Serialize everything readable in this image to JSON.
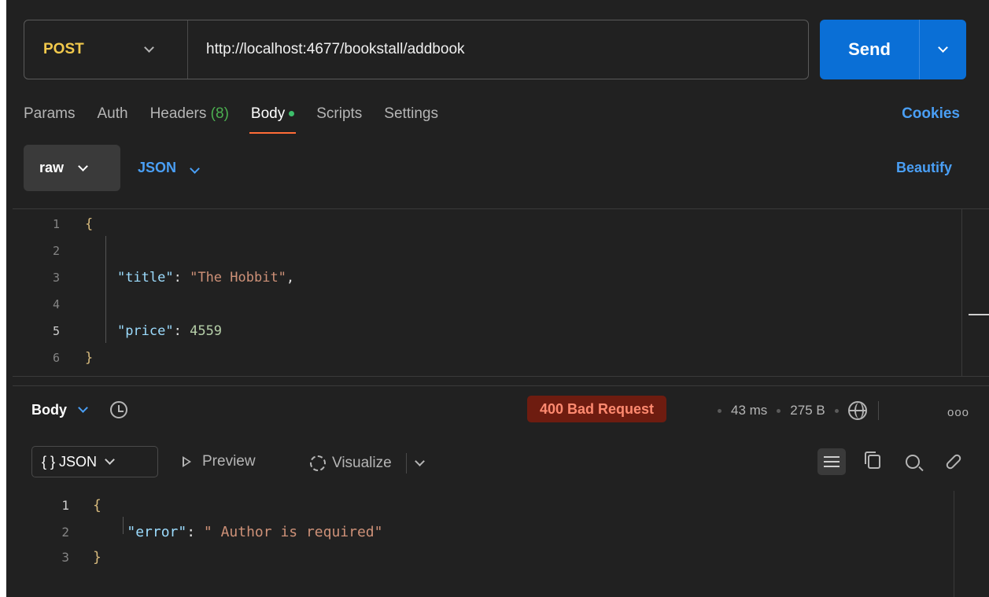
{
  "request": {
    "method": "POST",
    "url": "http://localhost:4677/bookstall/addbook",
    "send_label": "Send"
  },
  "tabs": {
    "params": "Params",
    "auth": "Auth",
    "headers": "Headers",
    "headers_count": "(8)",
    "body": "Body",
    "scripts": "Scripts",
    "settings": "Settings",
    "cookies": "Cookies"
  },
  "body_type": {
    "mode": "raw",
    "language": "JSON",
    "beautify": "Beautify"
  },
  "request_body": {
    "line_numbers": [
      "1",
      "2",
      "3",
      "4",
      "5",
      "6"
    ],
    "open_brace": "{",
    "title_key": "\"title\"",
    "title_value": "\"The Hobbit\"",
    "price_key": "\"price\"",
    "price_value": "4559",
    "close_brace": "}"
  },
  "response": {
    "section_label": "Body",
    "status": "400 Bad Request",
    "time": "43 ms",
    "size": "275 B",
    "more": "ooo",
    "format_label": "{ } JSON",
    "preview": "Preview",
    "visualize": "Visualize"
  },
  "response_body": {
    "line_numbers": [
      "1",
      "2",
      "3"
    ],
    "open_brace": "{",
    "error_key": "\"error\"",
    "error_value": "\" Author is required\"",
    "close_brace": "}"
  },
  "colors": {
    "accent": "#0a6fd6",
    "method": "#f2c94c",
    "tab_underline": "#ff6c37",
    "status_bg": "#6e1c10",
    "status_text": "#ff8a70"
  }
}
